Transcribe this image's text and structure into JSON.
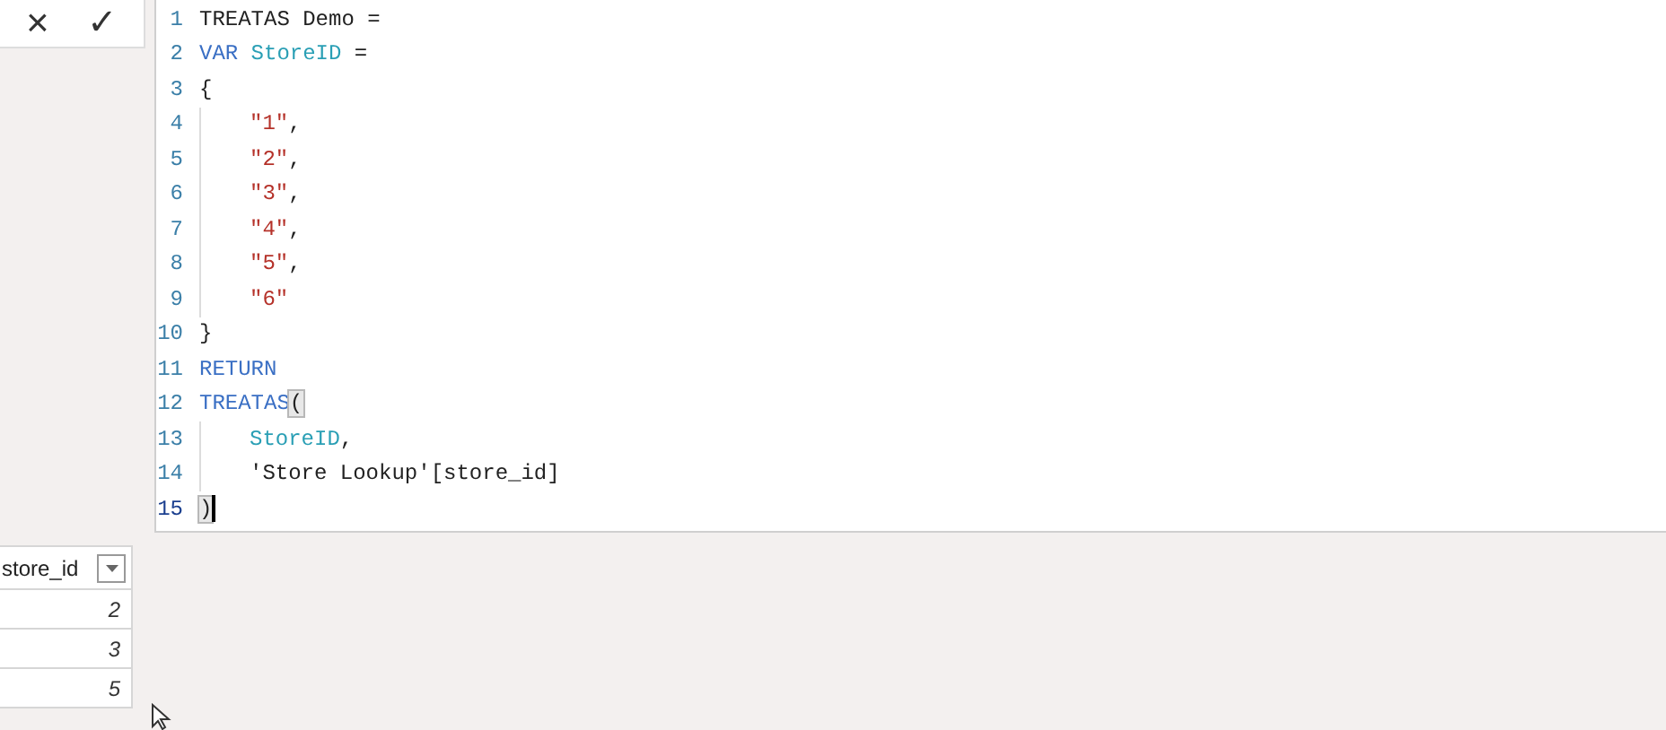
{
  "formula_bar": {
    "cancel_button": "×",
    "commit_button": "✓"
  },
  "editor": {
    "lines": [
      {
        "number": "1",
        "indent": false,
        "active": false,
        "tokens": [
          {
            "kind": "plain",
            "text": "TREATAS Demo ="
          }
        ]
      },
      {
        "number": "2",
        "indent": false,
        "active": false,
        "tokens": [
          {
            "kind": "keyword",
            "text": "VAR"
          },
          {
            "kind": "variable",
            "text": "StoreID",
            "spaced": true
          },
          {
            "kind": "plain",
            "text": " ="
          }
        ]
      },
      {
        "number": "3",
        "indent": false,
        "active": false,
        "tokens": [
          {
            "kind": "plain",
            "text": "{"
          }
        ]
      },
      {
        "number": "4",
        "indent": true,
        "active": false,
        "tokens": [
          {
            "kind": "string",
            "text": "\"1\""
          },
          {
            "kind": "plain",
            "text": ","
          }
        ]
      },
      {
        "number": "5",
        "indent": true,
        "active": false,
        "tokens": [
          {
            "kind": "string",
            "text": "\"2\""
          },
          {
            "kind": "plain",
            "text": ","
          }
        ]
      },
      {
        "number": "6",
        "indent": true,
        "active": false,
        "tokens": [
          {
            "kind": "string",
            "text": "\"3\""
          },
          {
            "kind": "plain",
            "text": ","
          }
        ]
      },
      {
        "number": "7",
        "indent": true,
        "active": false,
        "tokens": [
          {
            "kind": "string",
            "text": "\"4\""
          },
          {
            "kind": "plain",
            "text": ","
          }
        ]
      },
      {
        "number": "8",
        "indent": true,
        "active": false,
        "tokens": [
          {
            "kind": "string",
            "text": "\"5\""
          },
          {
            "kind": "plain",
            "text": ","
          }
        ]
      },
      {
        "number": "9",
        "indent": true,
        "active": false,
        "tokens": [
          {
            "kind": "string",
            "text": "\"6\""
          }
        ]
      },
      {
        "number": "10",
        "indent": false,
        "active": false,
        "tokens": [
          {
            "kind": "plain",
            "text": "}"
          }
        ]
      },
      {
        "number": "11",
        "indent": false,
        "active": false,
        "tokens": [
          {
            "kind": "keyword",
            "text": "RETURN"
          }
        ]
      },
      {
        "number": "12",
        "indent": false,
        "active": false,
        "tokens": [
          {
            "kind": "keyword",
            "text": "TREATAS"
          },
          {
            "kind": "bracket",
            "text": "("
          }
        ]
      },
      {
        "number": "13",
        "indent": true,
        "active": false,
        "tokens": [
          {
            "kind": "variable",
            "text": "StoreID"
          },
          {
            "kind": "plain",
            "text": ","
          }
        ]
      },
      {
        "number": "14",
        "indent": true,
        "active": false,
        "tokens": [
          {
            "kind": "plain",
            "text": "'Store Lookup'[store_id]"
          }
        ]
      },
      {
        "number": "15",
        "indent": false,
        "active": true,
        "tokens": [
          {
            "kind": "bracket",
            "text": ")"
          }
        ]
      }
    ]
  },
  "table": {
    "column": "store_id",
    "rows": [
      "2",
      "3",
      "5"
    ]
  }
}
